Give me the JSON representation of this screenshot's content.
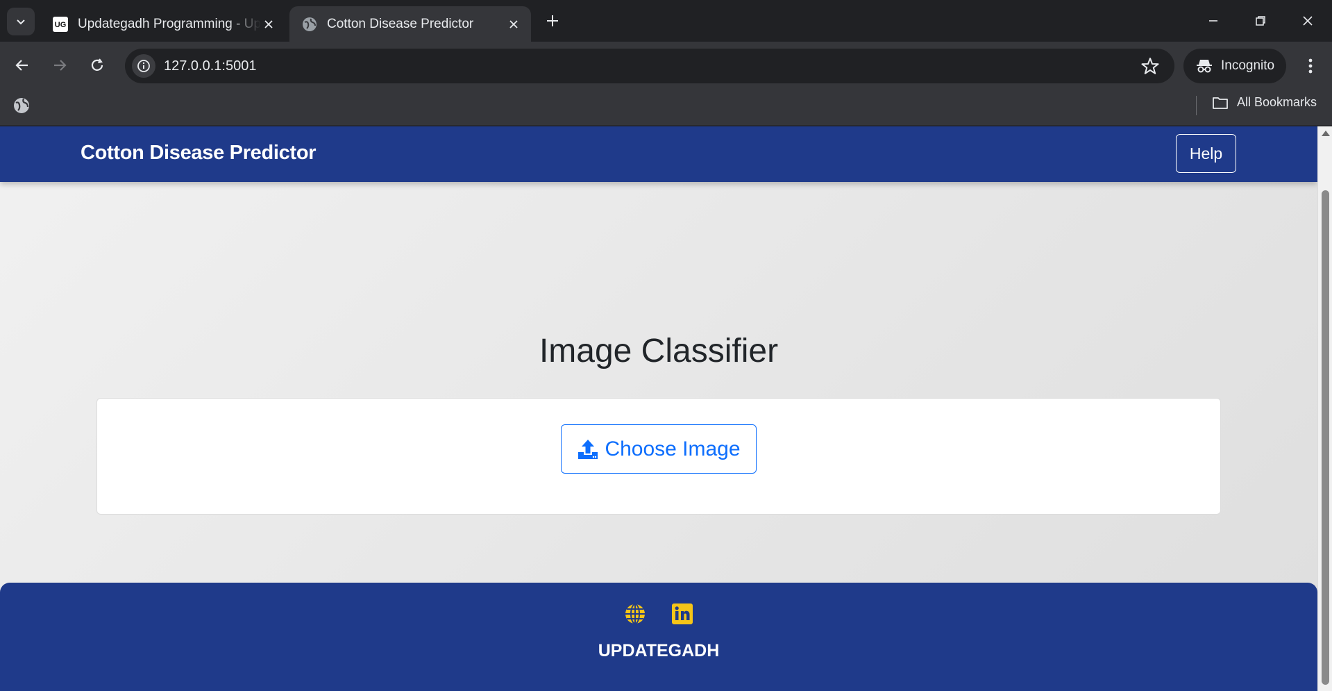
{
  "browser": {
    "tabs": [
      {
        "title": "Updategadh Programming - Up",
        "favicon": "updategadh-logo-icon",
        "active": false
      },
      {
        "title": "Cotton Disease Predictor",
        "favicon": "globe-icon",
        "active": true
      }
    ],
    "url": "127.0.0.1:5001",
    "profile_label": "Incognito",
    "bookmarks_label": "All Bookmarks"
  },
  "navbar": {
    "brand": "Cotton Disease Predictor",
    "help_label": "Help",
    "bg_color": "#1f3a8a"
  },
  "main": {
    "heading": "Image Classifier",
    "upload_button_label": "Choose Image",
    "upload_icon": "upload-icon",
    "accent_color": "#0d6efd"
  },
  "footer": {
    "icons": [
      "globe-icon",
      "linkedin-icon"
    ],
    "text": "UPDATEGADH",
    "icon_color": "#f5c518"
  }
}
